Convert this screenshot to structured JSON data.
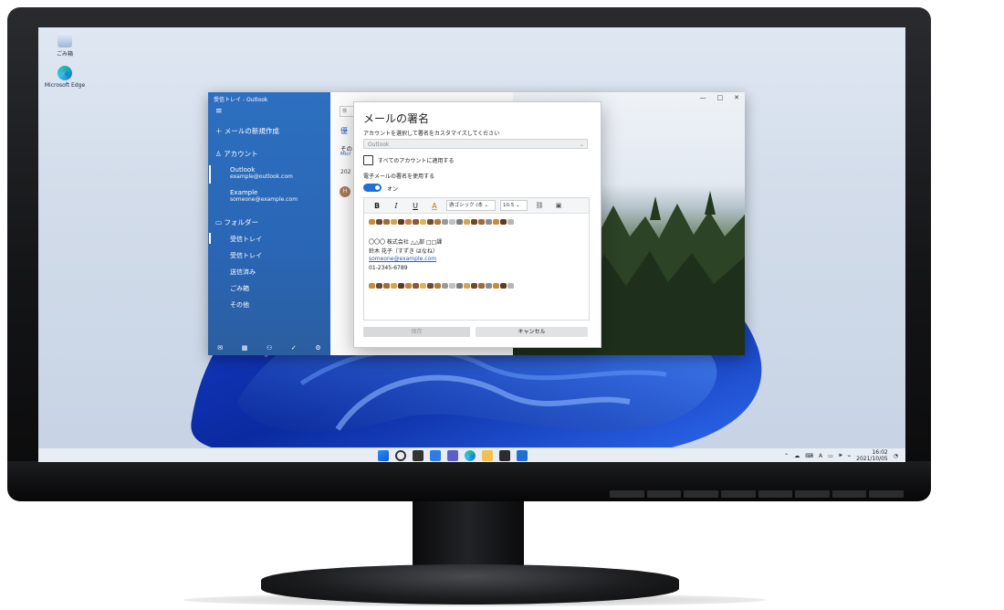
{
  "desktop": {
    "icons": [
      {
        "label": "ごみ箱",
        "icon": "recycle-bin-icon"
      },
      {
        "label": "Microsoft Edge",
        "icon": "edge-icon"
      }
    ]
  },
  "outlook": {
    "window_title": "受信トレイ - Outlook",
    "menu_icon": "hamburger-icon",
    "new_mail": "メールの新規作成",
    "accounts_header": "アカウント",
    "accounts": [
      {
        "name": "Outlook",
        "email": "example@outlook.com"
      },
      {
        "name": "Example",
        "email": "someone@example.com"
      }
    ],
    "folders_header": "フォルダー",
    "folders": [
      "受信トレイ",
      "受信トレイ",
      "送信済み",
      "ごみ箱",
      "その他"
    ],
    "list": {
      "search_fragment": "検",
      "tab_fragment": "優",
      "sender_fragment": "その",
      "sender_sub_fragment": "Micr",
      "date_fragment": "202",
      "avatar_letter": "H"
    },
    "window_controls": [
      "—",
      "□",
      "✕"
    ]
  },
  "dialog": {
    "title": "メールの署名",
    "account_prompt": "アカウントを選択して署名をカスタマイズしてください",
    "account_value": "Outlook",
    "apply_all_label": "すべてのアカウントに適用する",
    "apply_all_checked": false,
    "use_signature_label": "電子メールの署名を使用する",
    "toggle_state": "オン",
    "toolbar": {
      "bold": "B",
      "italic": "I",
      "underline": "U",
      "color": "A",
      "font": "游ゴシック (本",
      "size": "10.5"
    },
    "signature_lines": [
      "〇〇〇 株式会社 △△部 □□課",
      "鈴木 花子（すずき はなね）",
      "someone@example.com",
      "01-2345-6789"
    ],
    "save_label": "保存",
    "cancel_label": "キャンセル"
  },
  "taskbar": {
    "time": "16:02",
    "date": "2021/10/05",
    "ime": "A"
  },
  "colors": {
    "accent": "#1f6fd4",
    "sidebar": "#2a66b5",
    "link": "#1f5fbf"
  }
}
